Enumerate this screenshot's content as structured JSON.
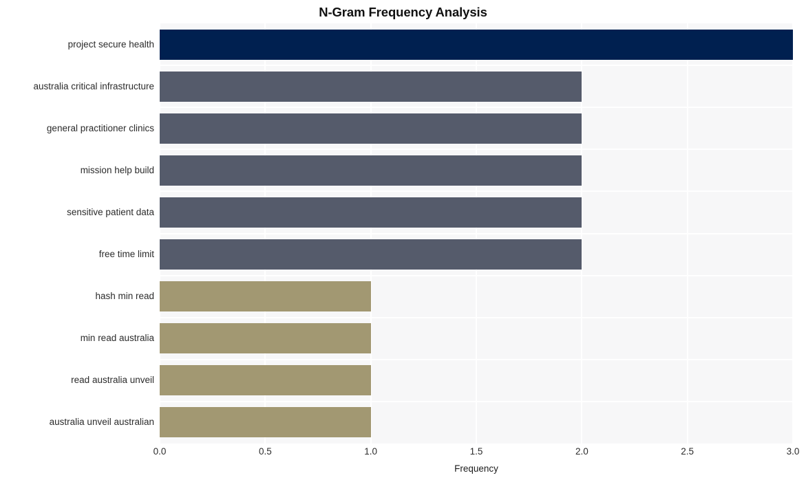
{
  "chart_data": {
    "type": "bar",
    "orientation": "horizontal",
    "title": "N-Gram Frequency Analysis",
    "xlabel": "Frequency",
    "ylabel": "",
    "categories": [
      "project secure health",
      "australia critical infrastructure",
      "general practitioner clinics",
      "mission help build",
      "sensitive patient data",
      "free time limit",
      "hash min read",
      "min read australia",
      "read australia unveil",
      "australia unveil australian"
    ],
    "values": [
      3,
      2,
      2,
      2,
      2,
      2,
      1,
      1,
      1,
      1
    ],
    "bar_colors": [
      "#002050",
      "#555b6b",
      "#555b6b",
      "#555b6b",
      "#555b6b",
      "#555b6b",
      "#a29872",
      "#a29872",
      "#a29872",
      "#a29872"
    ],
    "xlim": [
      0,
      3
    ],
    "xticks": [
      0,
      0.5,
      1,
      1.5,
      2,
      2.5,
      3
    ],
    "xticklabels": [
      "0.0",
      "0.5",
      "1.0",
      "1.5",
      "2.0",
      "2.5",
      "3.0"
    ],
    "grid": true,
    "grid_color": "#ffffff",
    "legend": false,
    "plot_background": "#f7f7f8",
    "figure_background": "#ffffff"
  }
}
